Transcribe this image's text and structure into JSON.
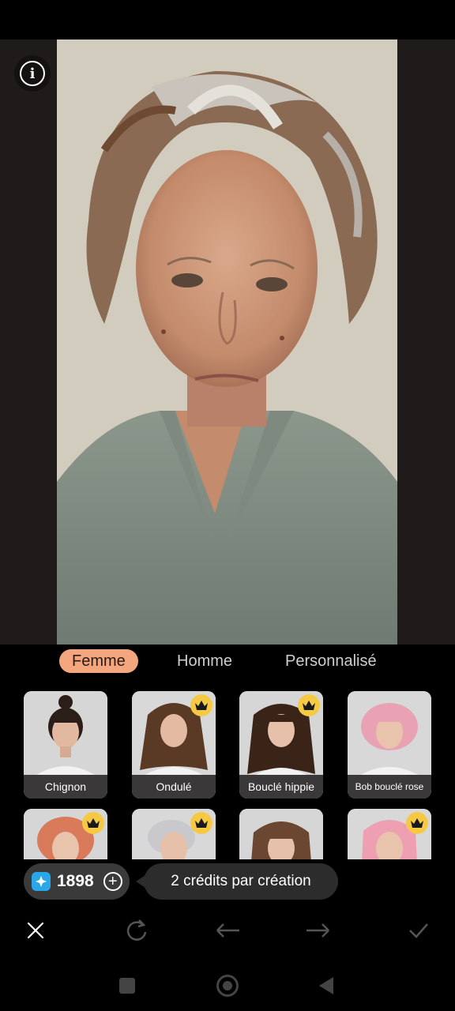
{
  "info_icon": "info-icon",
  "tabs": [
    {
      "label": "Femme",
      "active": true
    },
    {
      "label": "Homme",
      "active": false
    },
    {
      "label": "Personnalisé",
      "active": false
    }
  ],
  "styles_row1": [
    {
      "label": "Chignon",
      "premium": false,
      "hair": "#2b1d18"
    },
    {
      "label": "Ondulé",
      "premium": true,
      "hair": "#5a3a24"
    },
    {
      "label": "Bouclé hippie",
      "premium": true,
      "hair": "#3a2418"
    },
    {
      "label": "Bob bouclé rose",
      "premium": false,
      "hair": "#e9a1b4"
    }
  ],
  "styles_row2": [
    {
      "premium": true,
      "hair": "#d97a5a"
    },
    {
      "premium": true,
      "hair": "#c9c9cd"
    },
    {
      "premium": false,
      "hair": "#6b4630"
    },
    {
      "premium": true,
      "hair": "#ee9fb2"
    }
  ],
  "credits": {
    "count": "1898",
    "icon": "gem-icon"
  },
  "tooltip": "2 crédits par création",
  "toolbar": [
    "close-icon",
    "regenerate-icon",
    "undo-icon",
    "redo-icon",
    "confirm-icon"
  ],
  "navbar": [
    "recent-apps-icon",
    "home-icon",
    "back-icon"
  ],
  "colors": {
    "accent": "#f4a77e",
    "crown": "#f6c944",
    "gem": "#2aa7e8"
  }
}
